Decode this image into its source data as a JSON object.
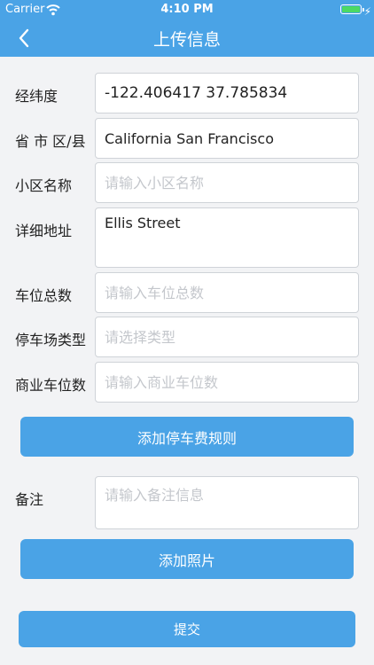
{
  "status_bar": {
    "carrier": "Carrier",
    "time": "4:10 PM"
  },
  "nav": {
    "title": "上传信息"
  },
  "form": {
    "coordinates": {
      "label": "经纬度",
      "value": "-122.406417 37.785834"
    },
    "region": {
      "label": "省 市 区/县",
      "value": "California San Francisco"
    },
    "community": {
      "label": "小区名称",
      "placeholder": "请输入小区名称"
    },
    "address": {
      "label": "详细地址",
      "value": "Ellis Street"
    },
    "total_spaces": {
      "label": "车位总数",
      "placeholder": "请输入车位总数"
    },
    "lot_type": {
      "label": "停车场类型",
      "placeholder": "请选择类型"
    },
    "commercial_spaces": {
      "label": "商业车位数",
      "placeholder": "请输入商业车位数"
    },
    "remarks": {
      "label": "备注",
      "placeholder": "请输入备注信息"
    }
  },
  "buttons": {
    "add_fee_rule": "添加停车费规则",
    "add_photo": "添加照片",
    "submit": "提交"
  },
  "colors": {
    "accent": "#4aa3e6",
    "background": "#f2f3f5",
    "battery": "#4cd964"
  },
  "icons": {
    "back": "chevron-left-icon",
    "wifi": "wifi-icon",
    "battery": "battery-icon",
    "charging": "lightning-bolt-icon"
  }
}
